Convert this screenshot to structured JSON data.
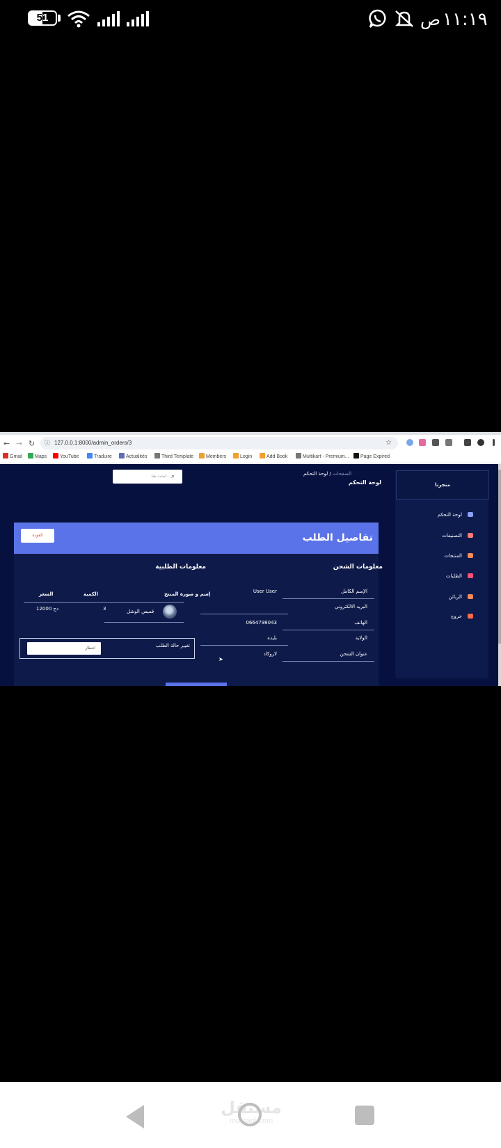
{
  "status_bar": {
    "time": "١١:١٩",
    "ampm": "ص",
    "battery": "51",
    "battery_level_pct": 51,
    "icons": [
      "wifi-icon",
      "signal-icon",
      "signal-icon",
      "whatsapp-icon",
      "mute-icon"
    ]
  },
  "browser": {
    "url": "127.0.0.1:8000/admin_orders/3",
    "bookmarks": [
      {
        "label": "Gmail",
        "color": "#d93025"
      },
      {
        "label": "Maps",
        "color": "#34a853"
      },
      {
        "label": "YouTube",
        "color": "#ff0000"
      },
      {
        "label": "Traduire",
        "color": "#4285f4"
      },
      {
        "label": "Actualités",
        "color": "#5f6eb5"
      },
      {
        "label": "Third Template",
        "color": "#777777"
      },
      {
        "label": "Members",
        "color": "#f0a030"
      },
      {
        "label": "Login",
        "color": "#f0a030"
      },
      {
        "label": "Add Book",
        "color": "#f0a030"
      },
      {
        "label": "Multikart - Premium...",
        "color": "#777777"
      },
      {
        "label": "Page Expired",
        "color": "#111111"
      }
    ]
  },
  "admin": {
    "brand": "متجرنا",
    "sidebar": [
      {
        "label": "لوحة التحكم",
        "icon": "monitor-icon",
        "color": "#8aa0ff"
      },
      {
        "label": "التصنيفات",
        "icon": "tag-icon",
        "color": "#ff7a7a"
      },
      {
        "label": "المنتجات",
        "icon": "box-icon",
        "color": "#ff8a55"
      },
      {
        "label": "الطلبات",
        "icon": "pin-icon",
        "color": "#ff4f7a"
      },
      {
        "label": "الزبائن",
        "icon": "users-icon",
        "color": "#ff8a55"
      },
      {
        "label": "خروج",
        "icon": "logout-icon",
        "color": "#ff6b4a"
      }
    ],
    "breadcrumb": {
      "parent": "الصفحات",
      "current": "لوحة التحكم"
    },
    "page_heading": "لوحة التحكم",
    "search_placeholder": "ابحث هنا...",
    "card": {
      "title": "تفاصيل الطلب",
      "back_label": "العودة",
      "shipping_title": "معلومات الشحن",
      "order_title": "معلومات الطلبية",
      "shipping_rows": [
        {
          "label": "الإسم الكامل",
          "value": "User User"
        },
        {
          "label": "البريد الالكتروني",
          "value": ""
        },
        {
          "label": "الهاتف",
          "value": "0664798043"
        },
        {
          "label": "الولاية",
          "value": "بليدة"
        },
        {
          "label": "عنوان الشحن",
          "value": "لاروكاد"
        }
      ],
      "order_table": {
        "headers": {
          "product": "إسم و صورة المنتج",
          "qty": "الكمية",
          "price": "السعر"
        },
        "rows": [
          {
            "product": "قميص الوشل",
            "qty": "3",
            "price": "12000 دج"
          }
        ]
      },
      "status_change_label": "تغيير حالة الطلب",
      "status_select_value": "انتظار"
    }
  },
  "watermark": {
    "line1": "مستقل",
    "line2": "mostaql.com"
  }
}
